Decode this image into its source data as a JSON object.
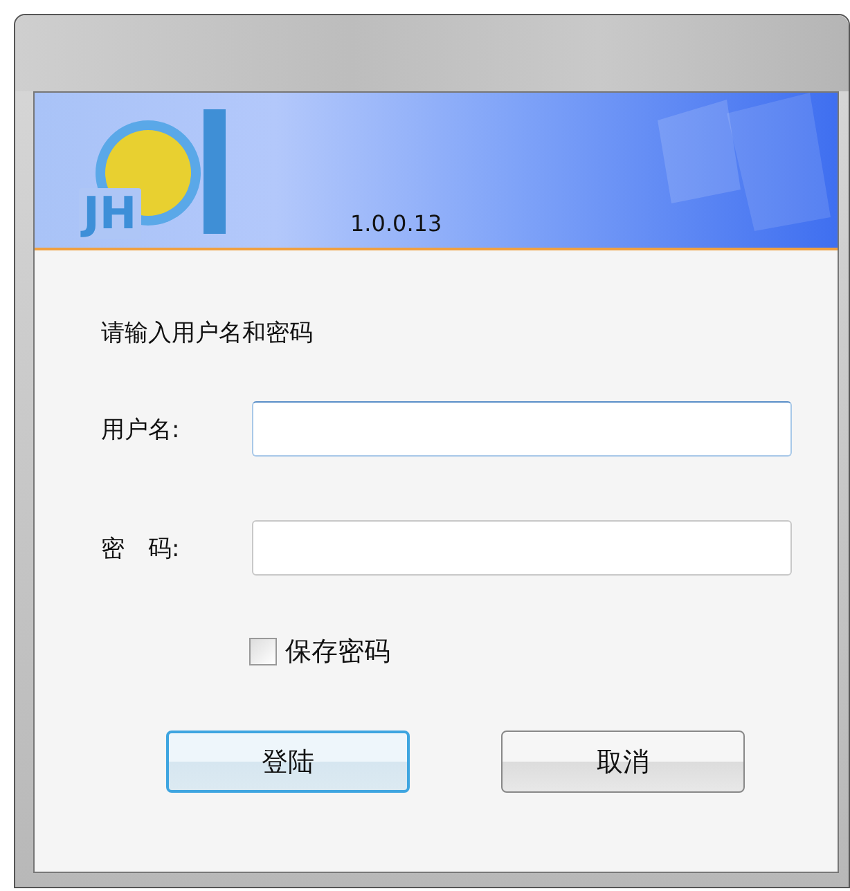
{
  "banner": {
    "logo_text": "JH",
    "version": "1.0.0.13"
  },
  "prompt": "请输入用户名和密码",
  "fields": [
    {
      "label": "用户名:",
      "focused": true
    },
    {
      "label": "密　码:",
      "focused": false
    }
  ],
  "remember": {
    "label": "保存密码",
    "checked": false
  },
  "buttons": [
    {
      "label": "登陆",
      "default": true
    },
    {
      "label": "取消",
      "default": false
    }
  ]
}
